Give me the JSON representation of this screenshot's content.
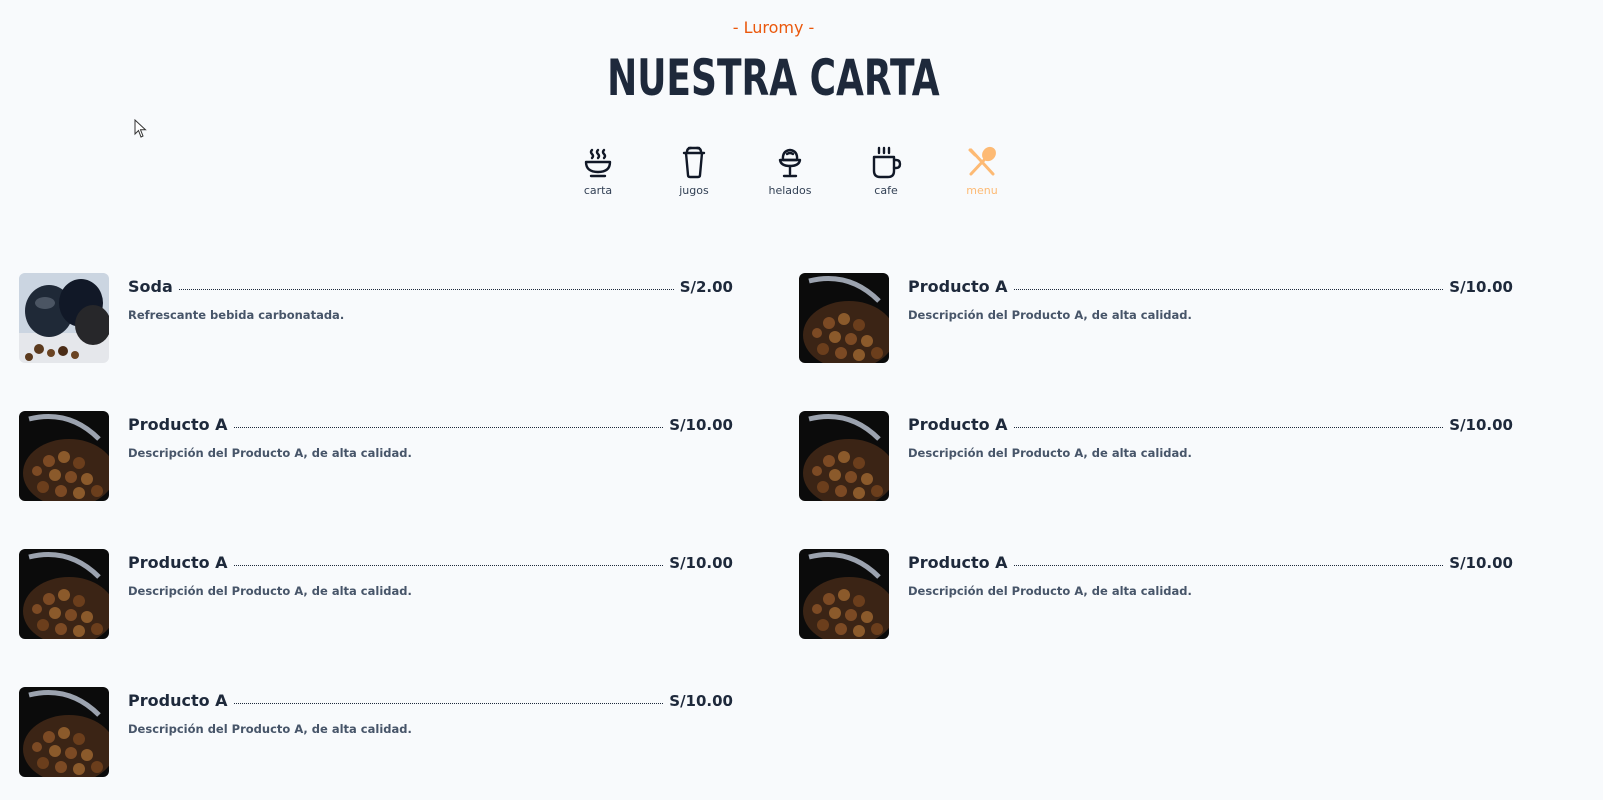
{
  "header": {
    "brand": "- Luromy -",
    "title": "NUESTRA CARTA"
  },
  "tabs": [
    {
      "label": "carta",
      "icon": "bowl-steam-icon",
      "active": false
    },
    {
      "label": "jugos",
      "icon": "cup-icon",
      "active": false
    },
    {
      "label": "helados",
      "icon": "ice-cream-icon",
      "active": false
    },
    {
      "label": "cafe",
      "icon": "coffee-mug-icon",
      "active": false
    },
    {
      "label": "menu",
      "icon": "utensils-icon",
      "active": true
    }
  ],
  "colors": {
    "accent": "#ea580c",
    "active_tab": "#fdba74",
    "text": "#1e293b",
    "muted": "#475569",
    "background": "#f8fafc"
  },
  "items": [
    {
      "name": "Soda",
      "price": "S/2.00",
      "description": "Refrescante bebida carbonatada.",
      "image": "coffee-capsules-image"
    },
    {
      "name": "Producto A",
      "price": "S/10.00",
      "description": "Descripción del Producto A, de alta calidad.",
      "image": "coffee-beans-cup-image"
    },
    {
      "name": "Producto A",
      "price": "S/10.00",
      "description": "Descripción del Producto A, de alta calidad.",
      "image": "coffee-beans-cup-image"
    },
    {
      "name": "Producto A",
      "price": "S/10.00",
      "description": "Descripción del Producto A, de alta calidad.",
      "image": "coffee-beans-cup-image"
    },
    {
      "name": "Producto A",
      "price": "S/10.00",
      "description": "Descripción del Producto A, de alta calidad.",
      "image": "coffee-beans-cup-image"
    },
    {
      "name": "Producto A",
      "price": "S/10.00",
      "description": "Descripción del Producto A, de alta calidad.",
      "image": "coffee-beans-cup-image"
    },
    {
      "name": "Producto A",
      "price": "S/10.00",
      "description": "Descripción del Producto A, de alta calidad.",
      "image": "coffee-beans-cup-image"
    }
  ]
}
